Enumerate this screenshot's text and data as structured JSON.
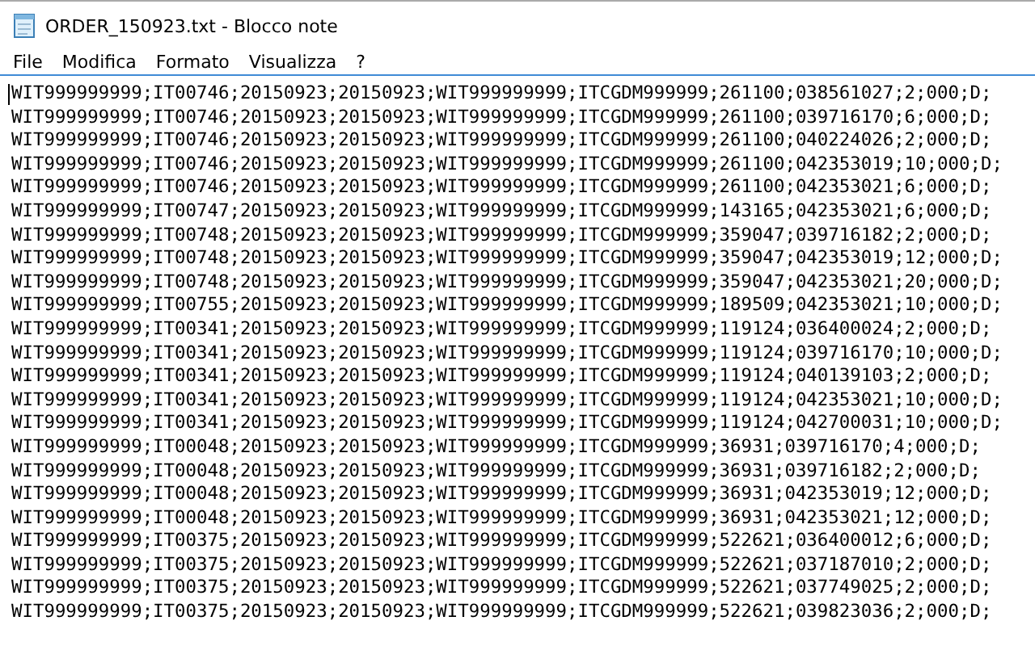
{
  "window": {
    "title": "ORDER_150923.txt - Blocco note"
  },
  "menu": [
    "File",
    "Modifica",
    "Formato",
    "Visualizza",
    "?"
  ],
  "lines": [
    "WIT999999999;IT00746;20150923;20150923;WIT999999999;ITCGDM999999;261100;038561027;2;000;D;",
    "WIT999999999;IT00746;20150923;20150923;WIT999999999;ITCGDM999999;261100;039716170;6;000;D;",
    "WIT999999999;IT00746;20150923;20150923;WIT999999999;ITCGDM999999;261100;040224026;2;000;D;",
    "WIT999999999;IT00746;20150923;20150923;WIT999999999;ITCGDM999999;261100;042353019;10;000;D;",
    "WIT999999999;IT00746;20150923;20150923;WIT999999999;ITCGDM999999;261100;042353021;6;000;D;",
    "WIT999999999;IT00747;20150923;20150923;WIT999999999;ITCGDM999999;143165;042353021;6;000;D;",
    "WIT999999999;IT00748;20150923;20150923;WIT999999999;ITCGDM999999;359047;039716182;2;000;D;",
    "WIT999999999;IT00748;20150923;20150923;WIT999999999;ITCGDM999999;359047;042353019;12;000;D;",
    "WIT999999999;IT00748;20150923;20150923;WIT999999999;ITCGDM999999;359047;042353021;20;000;D;",
    "WIT999999999;IT00755;20150923;20150923;WIT999999999;ITCGDM999999;189509;042353021;10;000;D;",
    "WIT999999999;IT00341;20150923;20150923;WIT999999999;ITCGDM999999;119124;036400024;2;000;D;",
    "WIT999999999;IT00341;20150923;20150923;WIT999999999;ITCGDM999999;119124;039716170;10;000;D;",
    "WIT999999999;IT00341;20150923;20150923;WIT999999999;ITCGDM999999;119124;040139103;2;000;D;",
    "WIT999999999;IT00341;20150923;20150923;WIT999999999;ITCGDM999999;119124;042353021;10;000;D;",
    "WIT999999999;IT00341;20150923;20150923;WIT999999999;ITCGDM999999;119124;042700031;10;000;D;",
    "WIT999999999;IT00048;20150923;20150923;WIT999999999;ITCGDM999999;36931;039716170;4;000;D;",
    "WIT999999999;IT00048;20150923;20150923;WIT999999999;ITCGDM999999;36931;039716182;2;000;D;",
    "WIT999999999;IT00048;20150923;20150923;WIT999999999;ITCGDM999999;36931;042353019;12;000;D;",
    "WIT999999999;IT00048;20150923;20150923;WIT999999999;ITCGDM999999;36931;042353021;12;000;D;",
    "WIT999999999;IT00375;20150923;20150923;WIT999999999;ITCGDM999999;522621;036400012;6;000;D;",
    "WIT999999999;IT00375;20150923;20150923;WIT999999999;ITCGDM999999;522621;037187010;2;000;D;",
    "WIT999999999;IT00375;20150923;20150923;WIT999999999;ITCGDM999999;522621;037749025;2;000;D;",
    "WIT999999999;IT00375;20150923;20150923;WIT999999999;ITCGDM999999;522621;039823036;2;000;D;"
  ]
}
